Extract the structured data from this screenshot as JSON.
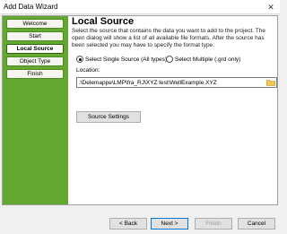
{
  "window": {
    "title": "Add Data Wizard",
    "close_glyph": "✕"
  },
  "steps": [
    "Welcome",
    "Start",
    "Local Source",
    "Object Type",
    "Finish"
  ],
  "main": {
    "heading": "Local Source",
    "description": "Select the source that contains the data you want to add to the project.  The open dialog will show a list of all available file formats. After the source has been selected you may have to specify the format type.",
    "radio_single": "Select Single Source (All types)",
    "radio_multiple": "Select Multiple (.grd only)",
    "location_label": "Location:",
    "location_value": ":\\Delemappe\\LMP\\fra_RJ\\XYZ test\\WellExample.XYZ",
    "source_settings": "Source Settings"
  },
  "buttons": {
    "back": "< Back",
    "next": "Next >",
    "finish": "Finish",
    "cancel": "Cancel"
  }
}
